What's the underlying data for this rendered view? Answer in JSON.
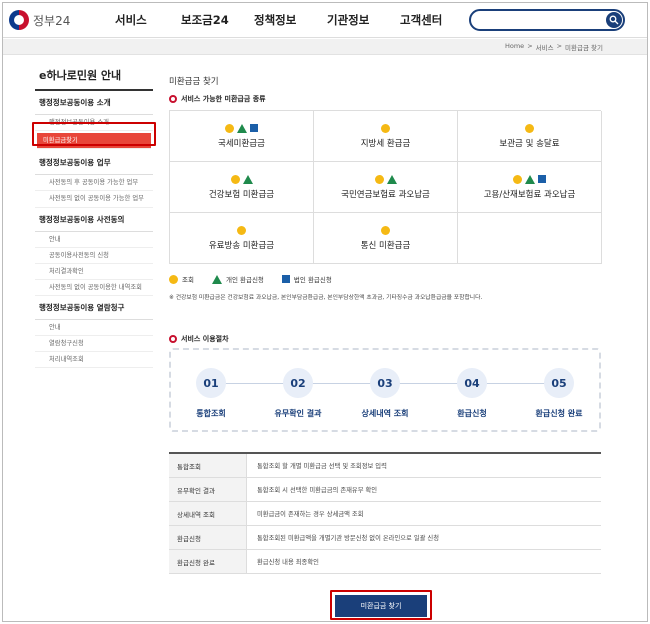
{
  "header": {
    "logo_text": "정부24",
    "nav": [
      "서비스",
      "보조금24",
      "정책정보",
      "기관정보",
      "고객센터"
    ],
    "search": {
      "placeholder": ""
    }
  },
  "breadcrumb": [
    "Home",
    ">",
    "서비스",
    ">",
    "미환급금 찾기"
  ],
  "sidebar": {
    "title": "e하나로민원 안내",
    "groups": [
      {
        "label": "행정정보공동이용 소개",
        "items": [
          "행정정보공동이용 소개",
          "미환급금찾기"
        ]
      },
      {
        "label": "행정정보공동이용 업무",
        "items": [
          "사전동의 후 공동이용 가능한 업무",
          "사전동의 없이 공동이용 가능한 업무"
        ]
      },
      {
        "label": "행정정보공동이용 사전동의",
        "items": [
          "안내",
          "공동이용사전동의 신청",
          "처리결과확인",
          "사전동의 없이 공동이용한 내역조회"
        ]
      },
      {
        "label": "행정정보공동이용 열람청구",
        "items": [
          "안내",
          "열람청구신청",
          "처리내역조회"
        ]
      }
    ],
    "active_item": "미환급금찾기"
  },
  "main": {
    "page_title": "미환급금 찾기",
    "types_heading": "서비스 가능한 미환급금 종류",
    "types": [
      {
        "label": "국세미환급금",
        "icons": [
          "circle",
          "triangle",
          "square"
        ]
      },
      {
        "label": "지방세 환급금",
        "icons": [
          "circle"
        ]
      },
      {
        "label": "보관금 및 송달료",
        "icons": [
          "circle"
        ]
      },
      {
        "label": "건강보험 미환급금",
        "icons": [
          "circle",
          "triangle"
        ]
      },
      {
        "label": "국민연금보험료 과오납금",
        "icons": [
          "circle",
          "triangle"
        ]
      },
      {
        "label": "고용/산재보험료 과오납금",
        "icons": [
          "circle",
          "triangle",
          "square"
        ]
      },
      {
        "label": "유료방송 미환급금",
        "icons": [
          "circle"
        ]
      },
      {
        "label": "통신 미환급금",
        "icons": [
          "circle"
        ]
      },
      {
        "label": "",
        "icons": []
      }
    ],
    "legend": {
      "circle": "조회",
      "triangle": "개인 환급신청",
      "square": "법인 환급신청"
    },
    "note": "※ 건강보험 미환급금은 건강보험료 과오납금, 본인부담금환급금, 본인부담상한액 초과금, 기타징수금 과오납환급금을 포함합니다.",
    "process_heading": "서비스 이용절차",
    "steps": [
      {
        "num": "01",
        "label": "통합조회"
      },
      {
        "num": "02",
        "label": "유무확인 결과"
      },
      {
        "num": "03",
        "label": "상세내역 조회"
      },
      {
        "num": "04",
        "label": "환급신청"
      },
      {
        "num": "05",
        "label": "환급신청 완료"
      }
    ],
    "table": [
      {
        "k": "통합조회",
        "v": "통합조회 할 개별 미환급금 선택 및 조회정보 입력"
      },
      {
        "k": "유무확인 결과",
        "v": "통합조회 시 선택한 미환급금의 존재유무 확인"
      },
      {
        "k": "상세내역 조회",
        "v": "미환급금이 존재하는 경우 상세금액 조회"
      },
      {
        "k": "환급신청",
        "v": "통합조회된 미환급액을 개별기관 방문신청 없이 온라인으로 일괄 신청"
      },
      {
        "k": "환급신청 완료",
        "v": "환급신청 내용 최종확인"
      }
    ],
    "cta_label": "미환급금 찾기"
  },
  "colors": {
    "accent": "#1a3f7a",
    "active_red": "#e8463a",
    "highlight_border": "#cc0000",
    "circle": "#f5b914",
    "triangle": "#1f8a4c",
    "square": "#1b5fa8"
  }
}
